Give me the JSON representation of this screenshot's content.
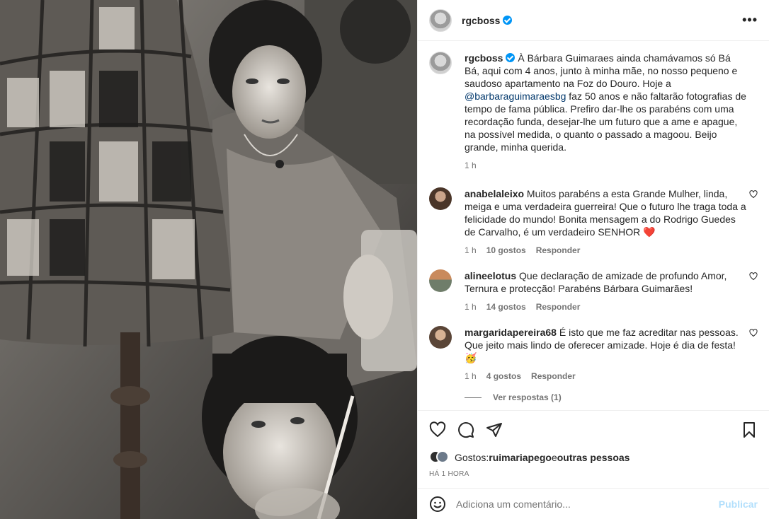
{
  "post": {
    "username": "rgcboss",
    "verified": true,
    "more_glyph": "•••",
    "caption_text": " À Bárbara Guimaraes ainda chamávamos só Bá Bá, aqui com 4 anos, junto à minha mãe, no nosso pequeno e saudoso apartamento na Foz do Douro. Hoje a ",
    "caption_mention": "@barbaraguimaraesbg",
    "caption_text2": " faz 50 anos e não faltarão fotografias de tempo de fama pública. Prefiro dar-lhe os parabéns com uma recordação funda, desejar-lhe um futuro que a ame e apague, na possível medida, o quanto o passado a magoou. Beijo grande, minha querida.",
    "caption_time": "1 h"
  },
  "comments": [
    {
      "username": "anabelaleixo",
      "text": " Muitos parabéns a esta Grande Mulher, linda, meiga e uma verdadeira guerreira! Que o futuro lhe traga toda a felicidade do mundo! Bonita mensagem a do Rodrigo Guedes de Carvalho, é um verdadeiro SENHOR ",
      "emoji": "❤️",
      "time": "1 h",
      "likes": "10 gostos",
      "reply": "Responder"
    },
    {
      "username": "alineelotus",
      "text": " Que declaração de amizade de profundo Amor, Ternura e protecção! Parabéns Bárbara Guimarães!",
      "emoji": "",
      "time": "1 h",
      "likes": "14 gostos",
      "reply": "Responder"
    },
    {
      "username": "margaridapereira68",
      "text": " É isto que me faz acreditar nas pessoas. Que jeito mais lindo de oferecer amizade. Hoje é dia de festa! ",
      "emoji": "🥳",
      "time": "1 h",
      "likes": "4 gostos",
      "reply": "Responder",
      "view_replies": "Ver respostas (1)"
    }
  ],
  "footer": {
    "likes_prefix": "Gostos: ",
    "likes_user": "ruimariapego",
    "likes_and": " e ",
    "likes_others": "outras pessoas",
    "timestamp": "HÁ 1 HORA",
    "comment_placeholder": "Adiciona um comentário...",
    "publish_label": "Publicar"
  },
  "icons": {
    "like": "heart-icon",
    "comment": "comment-icon",
    "share": "share-icon",
    "save": "bookmark-icon",
    "emoji": "emoji-icon"
  },
  "colors": {
    "verified_blue": "#0095f6",
    "mention": "#00376b",
    "heart_red": "#e0245e",
    "publish_disabled": "#b2dffc",
    "muted": "#737373"
  }
}
